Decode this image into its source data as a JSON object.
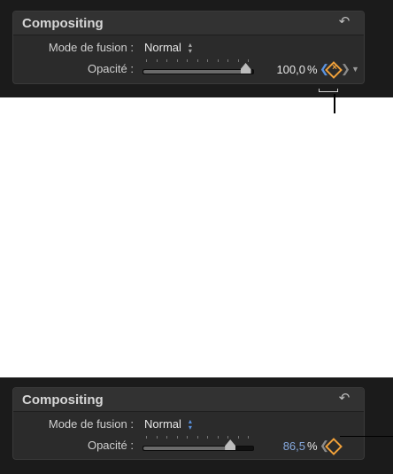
{
  "panels": [
    {
      "title": "Compositing",
      "blend_label": "Mode de fusion :",
      "blend_value": "Normal",
      "opacity_label": "Opacité :",
      "opacity_value": "100,0",
      "opacity_unit": "%",
      "opacity_level": 1.0,
      "keyframe_active": true
    },
    {
      "title": "Compositing",
      "blend_label": "Mode de fusion :",
      "blend_value": "Normal",
      "opacity_label": "Opacité :",
      "opacity_value": "86,5",
      "opacity_unit": "%",
      "opacity_level": 0.865,
      "keyframe_active": true
    }
  ],
  "icons": {
    "reset": "reset-arrow-icon",
    "popup": "updown-arrows-icon",
    "keyframe": "keyframe-diamond-icon",
    "prev": "previous-keyframe-icon",
    "next": "next-keyframe-icon",
    "menu": "animation-menu-icon"
  },
  "colors": {
    "accent_orange": "#f0a13a",
    "accent_blue": "#5b93e0",
    "value_blue": "#86a9de"
  }
}
